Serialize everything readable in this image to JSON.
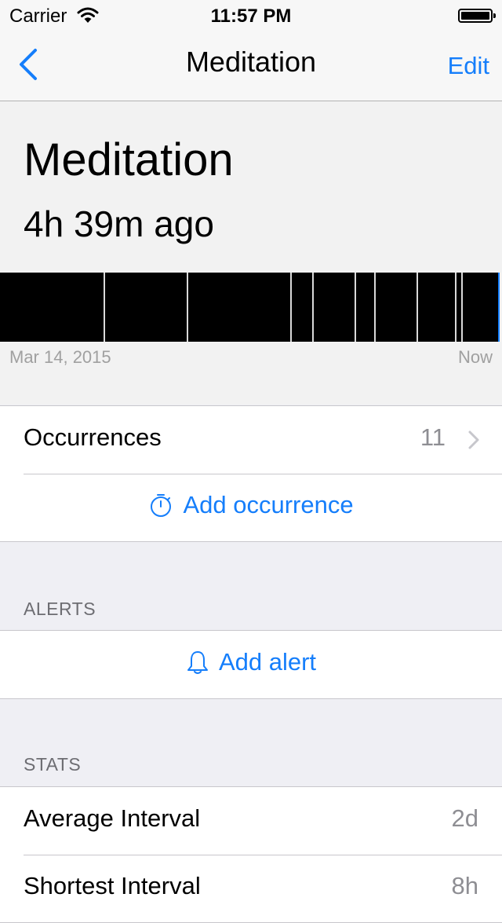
{
  "status_bar": {
    "carrier": "Carrier",
    "time": "11:57 PM"
  },
  "nav": {
    "title": "Meditation",
    "edit_label": "Edit"
  },
  "header": {
    "title": "Meditation",
    "subtitle": "4h 39m ago"
  },
  "timeline": {
    "start_label": "Mar 14, 2015",
    "end_label": "Now"
  },
  "occurrences": {
    "label": "Occurrences",
    "count": "11",
    "add_label": "Add occurrence"
  },
  "alerts": {
    "header": "ALERTS",
    "add_label": "Add alert"
  },
  "stats": {
    "header": "STATS",
    "rows": [
      {
        "label": "Average Interval",
        "value": "2d"
      },
      {
        "label": "Shortest Interval",
        "value": "8h"
      }
    ]
  },
  "colors": {
    "accent": "#157efb",
    "background": "#efeff4",
    "timeline_bar": "#000000"
  },
  "icons": [
    "wifi-icon",
    "battery-icon",
    "back-chevron-icon",
    "chevron-right-icon",
    "stopwatch-icon",
    "bell-icon"
  ]
}
